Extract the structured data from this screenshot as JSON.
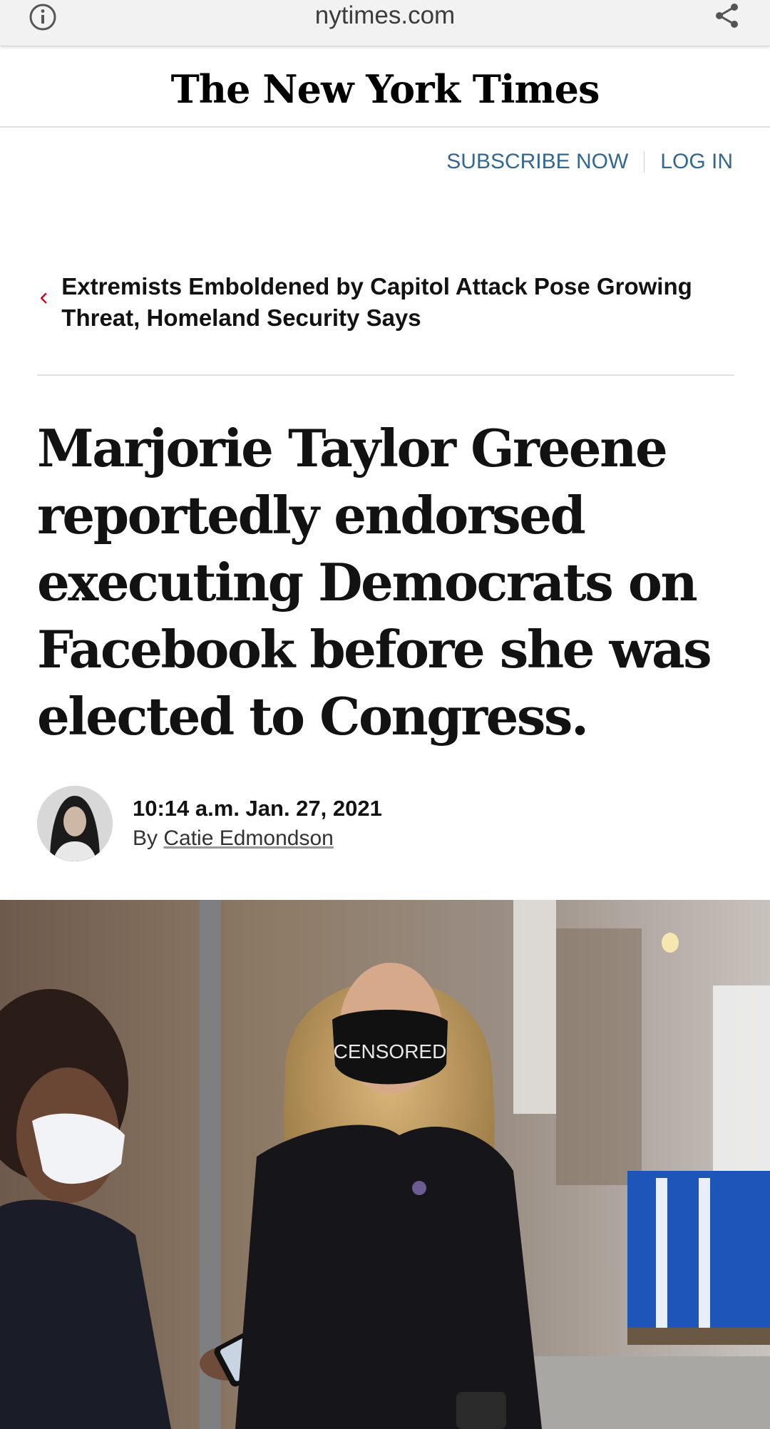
{
  "browser": {
    "url": "nytimes.com",
    "left_icon": "info-icon",
    "right_icon": "share-icon"
  },
  "masthead": {
    "logo": "The New York Times"
  },
  "auth": {
    "subscribe": "SUBSCRIBE NOW",
    "login": "LOG IN"
  },
  "previous_article": {
    "icon": "chevron-left-icon",
    "title": "Extremists Emboldened by Capitol Attack Pose Growing Threat, Homeland Security Says"
  },
  "article": {
    "headline": "Marjorie Taylor Greene reportedly endorsed executing Democrats on Facebook before she was elected to Congress.",
    "timestamp": "10:14 a.m. Jan. 27, 2021",
    "by_prefix": "By",
    "author": "Catie Edmondson",
    "photo": {
      "mask_text": "CENSORED"
    }
  },
  "colors": {
    "link_blue": "#326891",
    "chevron_red": "#d0021b",
    "text": "#121212"
  }
}
